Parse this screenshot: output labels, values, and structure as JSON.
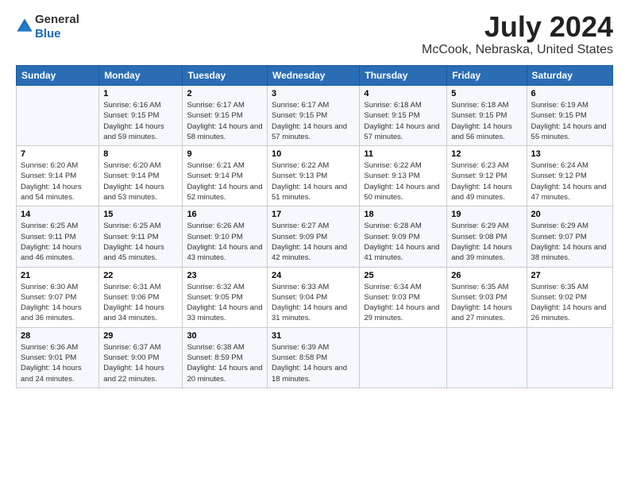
{
  "logo": {
    "general": "General",
    "blue": "Blue"
  },
  "title": "July 2024",
  "subtitle": "McCook, Nebraska, United States",
  "days_of_week": [
    "Sunday",
    "Monday",
    "Tuesday",
    "Wednesday",
    "Thursday",
    "Friday",
    "Saturday"
  ],
  "weeks": [
    [
      {
        "day": "",
        "sunrise": "",
        "sunset": "",
        "daylight": ""
      },
      {
        "day": "1",
        "sunrise": "Sunrise: 6:16 AM",
        "sunset": "Sunset: 9:15 PM",
        "daylight": "Daylight: 14 hours and 59 minutes."
      },
      {
        "day": "2",
        "sunrise": "Sunrise: 6:17 AM",
        "sunset": "Sunset: 9:15 PM",
        "daylight": "Daylight: 14 hours and 58 minutes."
      },
      {
        "day": "3",
        "sunrise": "Sunrise: 6:17 AM",
        "sunset": "Sunset: 9:15 PM",
        "daylight": "Daylight: 14 hours and 57 minutes."
      },
      {
        "day": "4",
        "sunrise": "Sunrise: 6:18 AM",
        "sunset": "Sunset: 9:15 PM",
        "daylight": "Daylight: 14 hours and 57 minutes."
      },
      {
        "day": "5",
        "sunrise": "Sunrise: 6:18 AM",
        "sunset": "Sunset: 9:15 PM",
        "daylight": "Daylight: 14 hours and 56 minutes."
      },
      {
        "day": "6",
        "sunrise": "Sunrise: 6:19 AM",
        "sunset": "Sunset: 9:15 PM",
        "daylight": "Daylight: 14 hours and 55 minutes."
      }
    ],
    [
      {
        "day": "7",
        "sunrise": "Sunrise: 6:20 AM",
        "sunset": "Sunset: 9:14 PM",
        "daylight": "Daylight: 14 hours and 54 minutes."
      },
      {
        "day": "8",
        "sunrise": "Sunrise: 6:20 AM",
        "sunset": "Sunset: 9:14 PM",
        "daylight": "Daylight: 14 hours and 53 minutes."
      },
      {
        "day": "9",
        "sunrise": "Sunrise: 6:21 AM",
        "sunset": "Sunset: 9:14 PM",
        "daylight": "Daylight: 14 hours and 52 minutes."
      },
      {
        "day": "10",
        "sunrise": "Sunrise: 6:22 AM",
        "sunset": "Sunset: 9:13 PM",
        "daylight": "Daylight: 14 hours and 51 minutes."
      },
      {
        "day": "11",
        "sunrise": "Sunrise: 6:22 AM",
        "sunset": "Sunset: 9:13 PM",
        "daylight": "Daylight: 14 hours and 50 minutes."
      },
      {
        "day": "12",
        "sunrise": "Sunrise: 6:23 AM",
        "sunset": "Sunset: 9:12 PM",
        "daylight": "Daylight: 14 hours and 49 minutes."
      },
      {
        "day": "13",
        "sunrise": "Sunrise: 6:24 AM",
        "sunset": "Sunset: 9:12 PM",
        "daylight": "Daylight: 14 hours and 47 minutes."
      }
    ],
    [
      {
        "day": "14",
        "sunrise": "Sunrise: 6:25 AM",
        "sunset": "Sunset: 9:11 PM",
        "daylight": "Daylight: 14 hours and 46 minutes."
      },
      {
        "day": "15",
        "sunrise": "Sunrise: 6:25 AM",
        "sunset": "Sunset: 9:11 PM",
        "daylight": "Daylight: 14 hours and 45 minutes."
      },
      {
        "day": "16",
        "sunrise": "Sunrise: 6:26 AM",
        "sunset": "Sunset: 9:10 PM",
        "daylight": "Daylight: 14 hours and 43 minutes."
      },
      {
        "day": "17",
        "sunrise": "Sunrise: 6:27 AM",
        "sunset": "Sunset: 9:09 PM",
        "daylight": "Daylight: 14 hours and 42 minutes."
      },
      {
        "day": "18",
        "sunrise": "Sunrise: 6:28 AM",
        "sunset": "Sunset: 9:09 PM",
        "daylight": "Daylight: 14 hours and 41 minutes."
      },
      {
        "day": "19",
        "sunrise": "Sunrise: 6:29 AM",
        "sunset": "Sunset: 9:08 PM",
        "daylight": "Daylight: 14 hours and 39 minutes."
      },
      {
        "day": "20",
        "sunrise": "Sunrise: 6:29 AM",
        "sunset": "Sunset: 9:07 PM",
        "daylight": "Daylight: 14 hours and 38 minutes."
      }
    ],
    [
      {
        "day": "21",
        "sunrise": "Sunrise: 6:30 AM",
        "sunset": "Sunset: 9:07 PM",
        "daylight": "Daylight: 14 hours and 36 minutes."
      },
      {
        "day": "22",
        "sunrise": "Sunrise: 6:31 AM",
        "sunset": "Sunset: 9:06 PM",
        "daylight": "Daylight: 14 hours and 34 minutes."
      },
      {
        "day": "23",
        "sunrise": "Sunrise: 6:32 AM",
        "sunset": "Sunset: 9:05 PM",
        "daylight": "Daylight: 14 hours and 33 minutes."
      },
      {
        "day": "24",
        "sunrise": "Sunrise: 6:33 AM",
        "sunset": "Sunset: 9:04 PM",
        "daylight": "Daylight: 14 hours and 31 minutes."
      },
      {
        "day": "25",
        "sunrise": "Sunrise: 6:34 AM",
        "sunset": "Sunset: 9:03 PM",
        "daylight": "Daylight: 14 hours and 29 minutes."
      },
      {
        "day": "26",
        "sunrise": "Sunrise: 6:35 AM",
        "sunset": "Sunset: 9:03 PM",
        "daylight": "Daylight: 14 hours and 27 minutes."
      },
      {
        "day": "27",
        "sunrise": "Sunrise: 6:35 AM",
        "sunset": "Sunset: 9:02 PM",
        "daylight": "Daylight: 14 hours and 26 minutes."
      }
    ],
    [
      {
        "day": "28",
        "sunrise": "Sunrise: 6:36 AM",
        "sunset": "Sunset: 9:01 PM",
        "daylight": "Daylight: 14 hours and 24 minutes."
      },
      {
        "day": "29",
        "sunrise": "Sunrise: 6:37 AM",
        "sunset": "Sunset: 9:00 PM",
        "daylight": "Daylight: 14 hours and 22 minutes."
      },
      {
        "day": "30",
        "sunrise": "Sunrise: 6:38 AM",
        "sunset": "Sunset: 8:59 PM",
        "daylight": "Daylight: 14 hours and 20 minutes."
      },
      {
        "day": "31",
        "sunrise": "Sunrise: 6:39 AM",
        "sunset": "Sunset: 8:58 PM",
        "daylight": "Daylight: 14 hours and 18 minutes."
      },
      {
        "day": "",
        "sunrise": "",
        "sunset": "",
        "daylight": ""
      },
      {
        "day": "",
        "sunrise": "",
        "sunset": "",
        "daylight": ""
      },
      {
        "day": "",
        "sunrise": "",
        "sunset": "",
        "daylight": ""
      }
    ]
  ]
}
